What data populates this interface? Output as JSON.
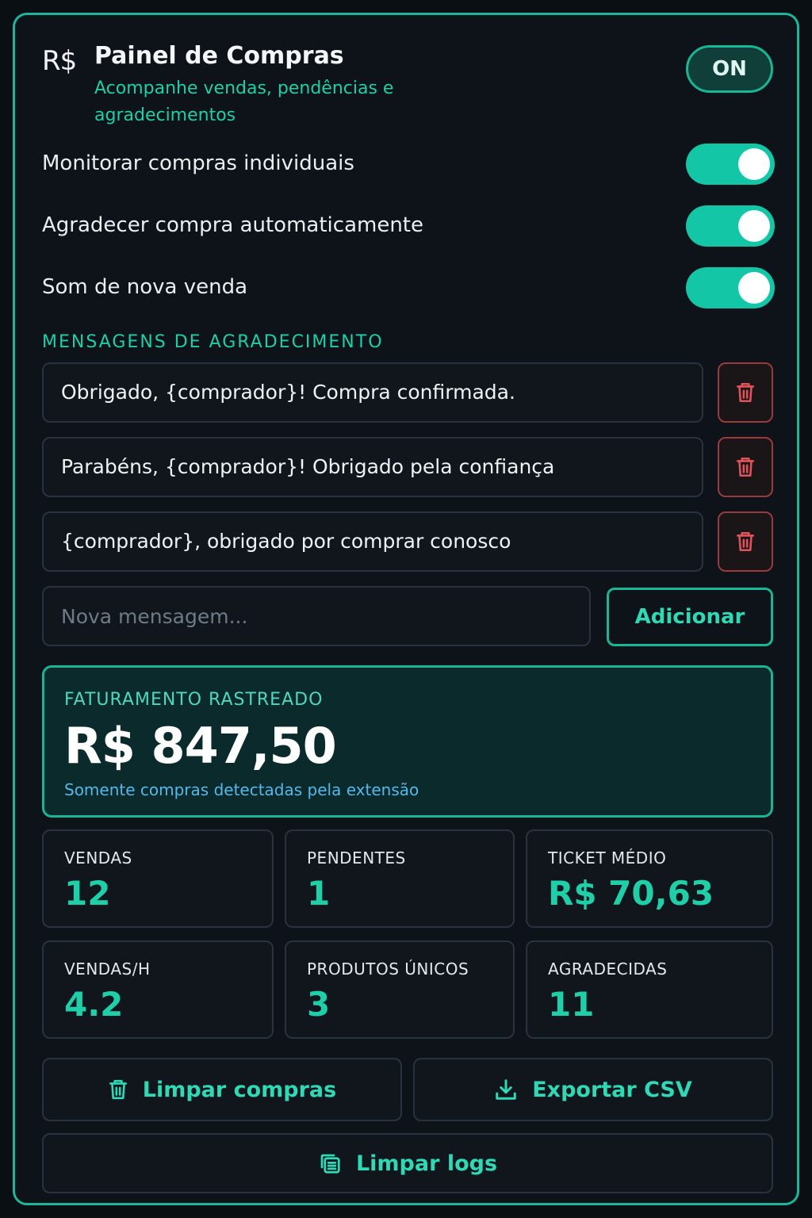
{
  "header": {
    "logo": "R$",
    "title": "Painel de Compras",
    "subtitle": "Acompanhe vendas, pendências e agradecimentos",
    "power_label": "ON"
  },
  "toggles": [
    {
      "label": "Monitorar compras individuais",
      "enabled": true
    },
    {
      "label": "Agradecer compra automaticamente",
      "enabled": true
    },
    {
      "label": "Som de nova venda",
      "enabled": true
    }
  ],
  "messages": {
    "section_title": "MENSAGENS DE AGRADECIMENTO",
    "items": [
      "Obrigado, {comprador}! Compra confirmada.",
      "Parabéns, {comprador}! Obrigado pela confiança",
      "{comprador}, obrigado por comprar conosco"
    ],
    "new_placeholder": "Nova mensagem...",
    "add_label": "Adicionar"
  },
  "revenue": {
    "label": "FATURAMENTO RASTREADO",
    "value": "R$ 847,50",
    "note": "Somente compras detectadas pela extensão"
  },
  "stats": [
    {
      "label": "VENDAS",
      "value": "12"
    },
    {
      "label": "PENDENTES",
      "value": "1"
    },
    {
      "label": "TICKET MÉDIO",
      "value": "R$ 70,63"
    },
    {
      "label": "VENDAS/H",
      "value": "4.2"
    },
    {
      "label": "PRODUTOS ÚNICOS",
      "value": "3"
    },
    {
      "label": "AGRADECIDAS",
      "value": "11"
    }
  ],
  "actions": {
    "clear_purchases": "Limpar compras",
    "export_csv": "Exportar CSV",
    "clear_logs": "Limpar logs"
  },
  "colors": {
    "accent": "#1fcfa7",
    "danger": "#e0535a",
    "background": "#0d1318",
    "info": "#56b8ea"
  },
  "icons": {
    "delete": "trash-icon",
    "export": "download-icon",
    "logs": "copy-icon"
  }
}
